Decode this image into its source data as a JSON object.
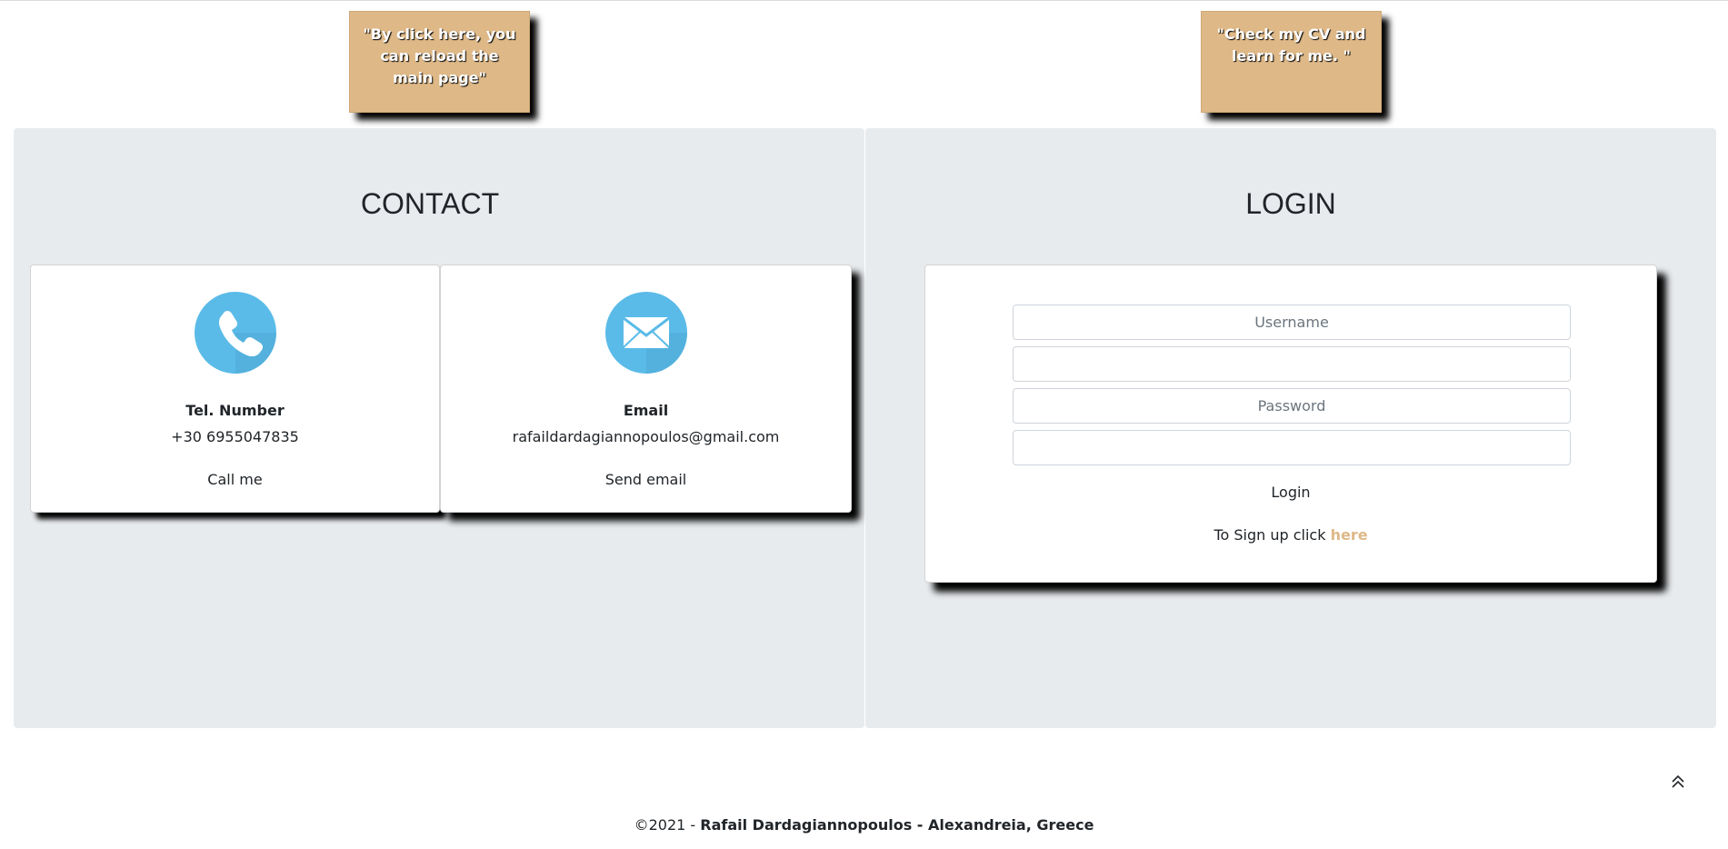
{
  "notes": {
    "home": "\"By click here, you can reload the main page\"",
    "cv": "\"Check my CV and learn for me. \""
  },
  "contact": {
    "title": "CONTACT",
    "phone": {
      "icon": "phone-icon",
      "label": "Tel. Number",
      "value": "+30 6955047835",
      "action": "Call me"
    },
    "email": {
      "icon": "envelope-icon",
      "label": "Email",
      "value": "rafaildardagiannopoulos@gmail.com",
      "action": "Send email"
    },
    "icon_color": "#5bbbe8"
  },
  "login": {
    "title": "LOGIN",
    "username_placeholder": "Username",
    "username_value": "",
    "password_placeholder": "Password",
    "password_value": "",
    "button": "Login",
    "signup_text": "To Sign up click ",
    "signup_link": "here"
  },
  "footer": {
    "copyright": "©2021 - ",
    "author": "Rafail Dardagiannopoulos - Alexandreia, Greece"
  },
  "colors": {
    "accent": "#deb887",
    "panel_bg": "#e8ebee"
  }
}
